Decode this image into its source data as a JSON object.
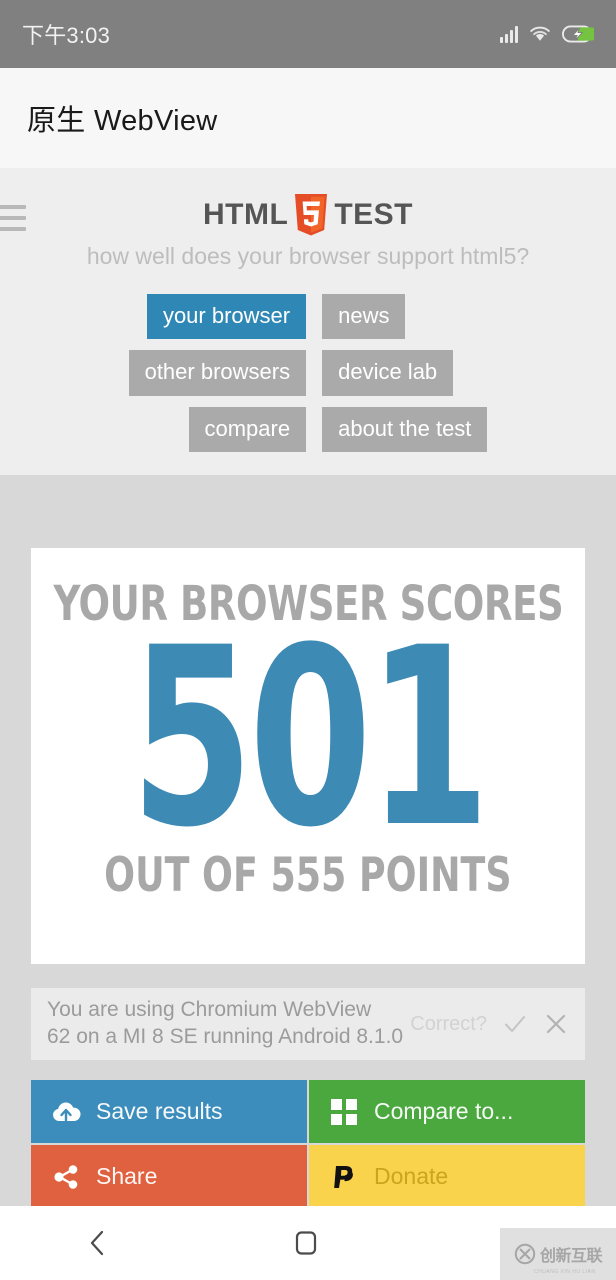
{
  "status_bar": {
    "time": "下午3:03",
    "icons": [
      "signal-icon",
      "wifi-icon",
      "battery-charging-icon"
    ]
  },
  "app_bar": {
    "title": "原生 WebView"
  },
  "site_header": {
    "menu_icon": "hamburger-menu-icon",
    "logo": {
      "word_left": "HTML",
      "shield": "html5-shield-logo",
      "word_right": "TEST"
    },
    "tagline": "how well does your browser support html5?",
    "nav_left": [
      {
        "label": "your browser",
        "active": true
      },
      {
        "label": "other browsers",
        "active": false
      },
      {
        "label": "compare",
        "active": false
      }
    ],
    "nav_right": [
      {
        "label": "news",
        "active": false
      },
      {
        "label": "device lab",
        "active": false
      },
      {
        "label": "about the test",
        "active": false
      }
    ]
  },
  "score_card": {
    "heading": "YOUR BROWSER SCORES",
    "score": "501",
    "footer": "OUT OF 555 POINTS",
    "max_points": 555
  },
  "browser_info": {
    "text": "You are using Chromium WebView 62 on a MI 8 SE running Android 8.1.0",
    "line1": "You are using Chromium WebView",
    "line2": "62 on a MI 8 SE running Android 8.1.0",
    "correct_label": "Correct?",
    "confirm_icon": "checkmark-icon",
    "reject_icon": "close-x-icon"
  },
  "actions": [
    {
      "label": "Save results",
      "icon": "cloud-upload-icon",
      "color": "#3c8dbc"
    },
    {
      "label": "Compare to...",
      "icon": "grid-icon",
      "color": "#4aa83f"
    },
    {
      "label": "Share",
      "icon": "share-nodes-icon",
      "color": "#e0613f"
    },
    {
      "label": "Donate",
      "icon": "paypal-icon",
      "color": "#f8d34b"
    }
  ],
  "android_nav": {
    "back": "back-chevron-icon",
    "home": "home-square-icon",
    "recents": "recents-menu-icon"
  },
  "watermark": {
    "text": "创新互联",
    "sub": "CHUANG XIN HU LIAN"
  },
  "colors": {
    "accent_blue": "#3d8ab5",
    "active_tab_blue": "#2e87b4",
    "nav_gray": "#aaaaaa",
    "header_bg": "#eeeeee",
    "content_bg": "#d8d8d8",
    "html5_orange": "#e44d26"
  }
}
